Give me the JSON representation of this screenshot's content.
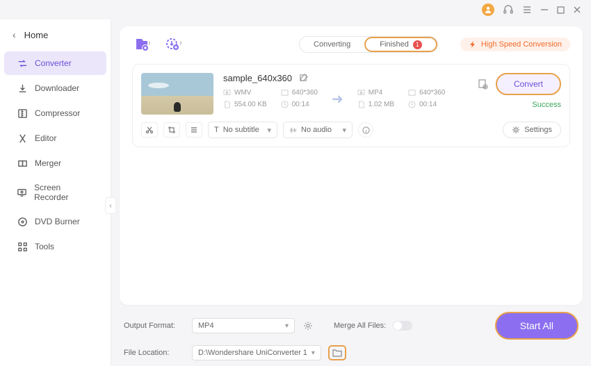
{
  "titlebar": {
    "user": "user-icon"
  },
  "sidebar": {
    "home": "Home",
    "items": [
      {
        "label": "Converter",
        "icon": "converter"
      },
      {
        "label": "Downloader",
        "icon": "downloader"
      },
      {
        "label": "Compressor",
        "icon": "compressor"
      },
      {
        "label": "Editor",
        "icon": "editor"
      },
      {
        "label": "Merger",
        "icon": "merger"
      },
      {
        "label": "Screen Recorder",
        "icon": "screen-recorder"
      },
      {
        "label": "DVD Burner",
        "icon": "dvd-burner"
      },
      {
        "label": "Tools",
        "icon": "tools"
      }
    ]
  },
  "tabs": {
    "converting": "Converting",
    "finished": "Finished",
    "finished_count": "1"
  },
  "high_speed": "High Speed Conversion",
  "file": {
    "name": "sample_640x360",
    "src": {
      "format": "WMV",
      "res": "640*360",
      "size": "554.00 KB",
      "dur": "00:14"
    },
    "dst": {
      "format": "MP4",
      "res": "640*360",
      "size": "1.02 MB",
      "dur": "00:14"
    },
    "convert_label": "Convert",
    "status": "Success",
    "subtitle": "No subtitle",
    "audio": "No audio",
    "settings": "Settings"
  },
  "bottom": {
    "output_label": "Output Format:",
    "output_value": "MP4",
    "location_label": "File Location:",
    "location_value": "D:\\Wondershare UniConverter 1",
    "merge_label": "Merge All Files:",
    "start_all": "Start All"
  }
}
